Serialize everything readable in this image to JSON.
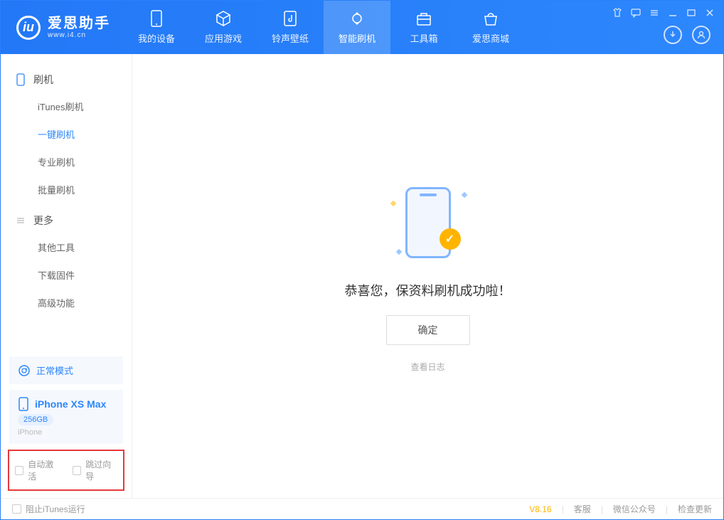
{
  "header": {
    "logo_title": "爱思助手",
    "logo_sub": "www.i4.cn",
    "nav": [
      {
        "label": "我的设备",
        "icon": "device-icon"
      },
      {
        "label": "应用游戏",
        "icon": "cube-icon"
      },
      {
        "label": "铃声壁纸",
        "icon": "music-icon"
      },
      {
        "label": "智能刷机",
        "icon": "refresh-icon"
      },
      {
        "label": "工具箱",
        "icon": "toolbox-icon"
      },
      {
        "label": "爱思商城",
        "icon": "shop-icon"
      }
    ],
    "active_nav_index": 3
  },
  "sidebar": {
    "sections": [
      {
        "title": "刷机",
        "icon": "phone-icon",
        "items": [
          "iTunes刷机",
          "一键刷机",
          "专业刷机",
          "批量刷机"
        ],
        "active_index": 1
      },
      {
        "title": "更多",
        "icon": "menu-icon",
        "items": [
          "其他工具",
          "下载固件",
          "高级功能"
        ],
        "active_index": -1
      }
    ],
    "mode": {
      "label": "正常模式"
    },
    "device": {
      "name": "iPhone XS Max",
      "capacity": "256GB",
      "type": "iPhone"
    },
    "options": {
      "auto_activate": "自动激活",
      "skip_guide": "跳过向导"
    }
  },
  "main": {
    "success_text": "恭喜您，保资料刷机成功啦！",
    "ok_label": "确定",
    "view_log_label": "查看日志"
  },
  "footer": {
    "block_itunes": "阻止iTunes运行",
    "version": "V8.16",
    "links": [
      "客服",
      "微信公众号",
      "检查更新"
    ]
  }
}
